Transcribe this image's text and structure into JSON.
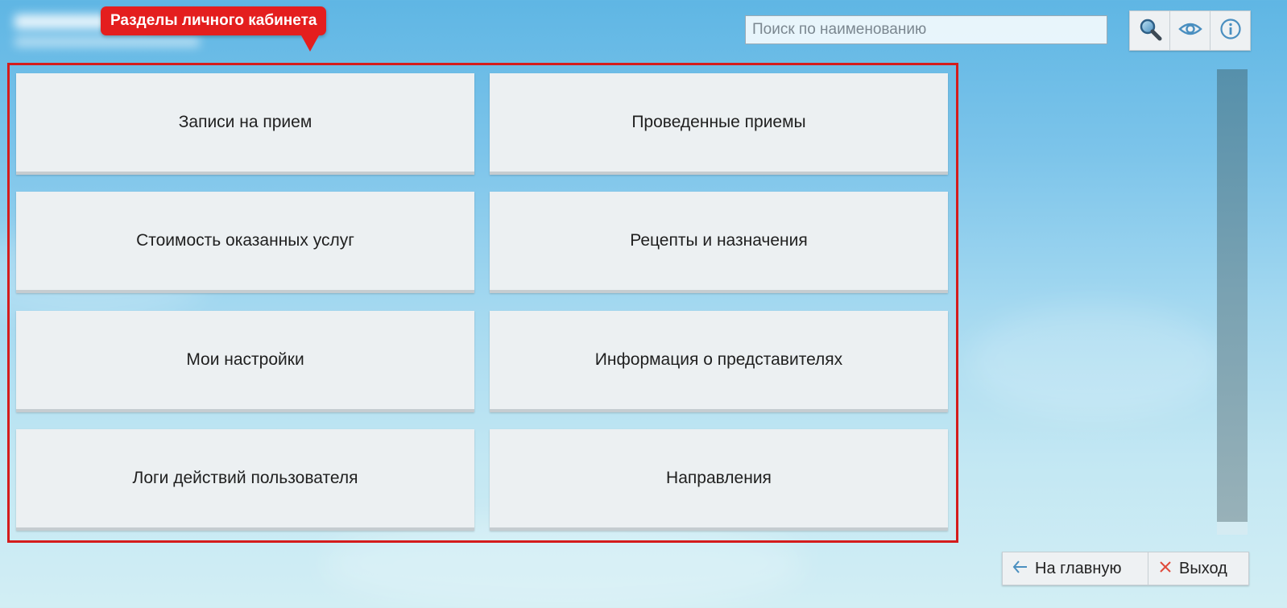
{
  "annotation": {
    "label": "Разделы личного кабинета"
  },
  "search": {
    "placeholder": "Поиск по наименованию",
    "value": ""
  },
  "toolbar": {
    "icons": [
      "search-icon",
      "eye-icon",
      "info-icon"
    ]
  },
  "sections": {
    "tiles": [
      {
        "label": "Записи на прием"
      },
      {
        "label": "Проведенные приемы"
      },
      {
        "label": "Стоимость оказанных услуг"
      },
      {
        "label": "Рецепты и назначения"
      },
      {
        "label": "Мои настройки"
      },
      {
        "label": "Информация о представителях"
      },
      {
        "label": "Логи действий пользователя"
      },
      {
        "label": "Направления"
      }
    ]
  },
  "footer": {
    "home_label": "На главную",
    "exit_label": "Выход"
  },
  "colors": {
    "annotation_red": "#e41e1e",
    "tile_background": "#ecf0f2",
    "scroll_thumb": "#6f9bb0"
  }
}
